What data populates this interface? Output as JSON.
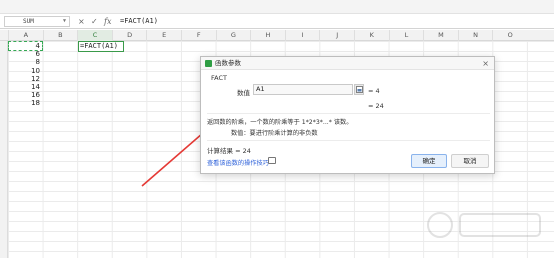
{
  "namebox": {
    "value": "SUM"
  },
  "formula_bar": {
    "cancel_glyph": "×",
    "confirm_glyph": "✓",
    "fx_label": "fx",
    "formula": "=FACT(A1)"
  },
  "columns": [
    "A",
    "B",
    "C",
    "D",
    "E",
    "F",
    "G",
    "H",
    "I",
    "J",
    "K",
    "L",
    "M",
    "N",
    "O"
  ],
  "column_a_values": [
    "4",
    "6",
    "8",
    "10",
    "12",
    "14",
    "16",
    "18"
  ],
  "active_cell": {
    "content": "=FACT(A1)"
  },
  "dialog": {
    "title": "函数参数",
    "close_glyph": "×",
    "function_name": "FACT",
    "arg_label": "数值",
    "arg_value": "A1",
    "arg_result": "= 4",
    "formula_result_preview": "= 24",
    "description": "返回数的阶乘，一个数的阶乘等于 1*2*3*...* 该数。",
    "param_description": "数值：要进行阶乘计算的非负数",
    "calc_result": "计算结果 = 24",
    "help_link": "查看该函数的操作技巧",
    "ok": "确定",
    "cancel": "取消"
  },
  "colors": {
    "accent_green": "#2f9e44",
    "arrow_red": "#e53935",
    "link_blue": "#2b5fd9"
  }
}
